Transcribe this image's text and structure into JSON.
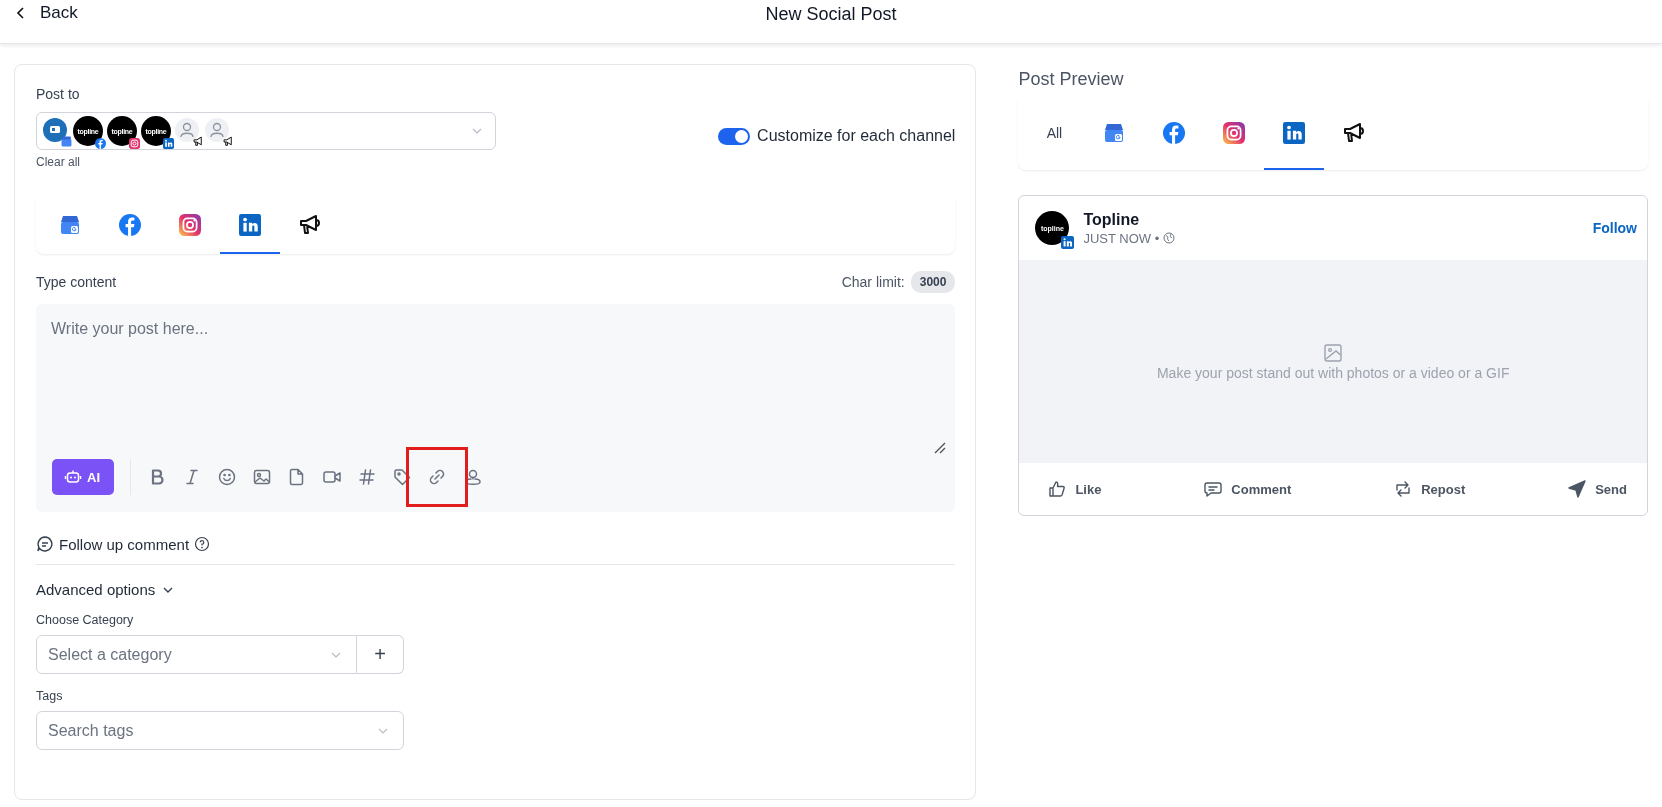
{
  "header": {
    "back_label": "Back",
    "title": "New Social Post"
  },
  "post_to": {
    "label": "Post to",
    "accounts": [
      {
        "kind": "brand",
        "badge": {
          "kind": "gmb"
        }
      },
      {
        "kind": "logo",
        "text": "topline",
        "badge": {
          "kind": "facebook"
        }
      },
      {
        "kind": "logo",
        "text": "topline",
        "badge": {
          "kind": "instagram"
        }
      },
      {
        "kind": "logo",
        "text": "topline",
        "badge": {
          "kind": "linkedin"
        }
      },
      {
        "kind": "person",
        "badge": {
          "kind": "megaphone"
        }
      },
      {
        "kind": "person",
        "badge": {
          "kind": "megaphone"
        }
      }
    ],
    "clear_label": "Clear all"
  },
  "customize": {
    "label": "Customize for each channel",
    "on": true
  },
  "channel_tabs": [
    {
      "kind": "gmb",
      "selected": false
    },
    {
      "kind": "facebook",
      "selected": false
    },
    {
      "kind": "instagram",
      "selected": false
    },
    {
      "kind": "linkedin",
      "selected": true
    },
    {
      "kind": "megaphone",
      "selected": false
    }
  ],
  "editor": {
    "label": "Type content",
    "char_limit_label": "Char limit:",
    "char_limit": "3000",
    "placeholder": "Write your post here...",
    "ai_label": "AI",
    "tools": [
      {
        "kind": "bold",
        "highlighted": false
      },
      {
        "kind": "italic",
        "highlighted": false
      },
      {
        "kind": "emoji",
        "highlighted": false
      },
      {
        "kind": "image",
        "highlighted": false
      },
      {
        "kind": "file",
        "highlighted": false
      },
      {
        "kind": "video",
        "highlighted": false
      },
      {
        "kind": "hashtag",
        "highlighted": false
      },
      {
        "kind": "tag",
        "highlighted": false
      },
      {
        "kind": "link",
        "highlighted": true
      },
      {
        "kind": "location",
        "highlighted": false
      }
    ]
  },
  "follow_up": {
    "label": "Follow up comment"
  },
  "advanced": {
    "label": "Advanced options",
    "expanded": true,
    "category": {
      "label": "Choose Category",
      "placeholder": "Select a category",
      "add": "+"
    },
    "tags": {
      "label": "Tags",
      "placeholder": "Search tags"
    }
  },
  "preview": {
    "title": "Post Preview",
    "tabs": [
      {
        "kind": "all",
        "label": "All",
        "selected": false
      },
      {
        "kind": "gmb",
        "selected": false
      },
      {
        "kind": "facebook",
        "selected": false
      },
      {
        "kind": "instagram",
        "selected": false
      },
      {
        "kind": "linkedin",
        "selected": true
      },
      {
        "kind": "megaphone",
        "selected": false
      }
    ],
    "post": {
      "avatar_text": "topline",
      "name": "Topline",
      "time": "JUST NOW •",
      "follow": "Follow",
      "media_hint": "Make your post stand out with photos or a video or a GIF",
      "actions": [
        {
          "kind": "like",
          "label": "Like"
        },
        {
          "kind": "comment",
          "label": "Comment"
        },
        {
          "kind": "repost",
          "label": "Repost"
        },
        {
          "kind": "send",
          "label": "Send"
        }
      ]
    }
  }
}
